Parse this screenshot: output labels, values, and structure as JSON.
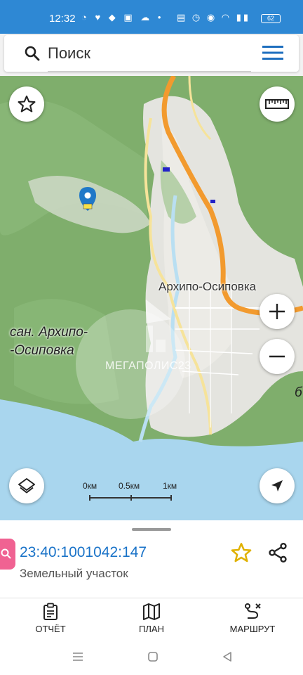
{
  "status_bar": {
    "time": "12:32",
    "battery": "62"
  },
  "search": {
    "placeholder": "Поиск"
  },
  "map": {
    "town_label": "Архипо-Осиповка",
    "sanatorium_label_line1": "сан. Архипо-",
    "sanatorium_label_line2": "-Осиповка",
    "edge_label": "б",
    "watermark": "МЕГАПОЛИС23",
    "scale": {
      "labels": [
        "0км",
        "0.5км",
        "1км"
      ]
    },
    "buttons": {
      "favorite": "star-icon",
      "ruler": "ruler-icon",
      "zoom_in": "plus-icon",
      "zoom_out": "minus-icon",
      "layers": "layers-icon",
      "locate": "navigation-arrow-icon"
    },
    "colors": {
      "forest": "#7fae6c",
      "urban": "#e4e4df",
      "sea": "#a9d6ee",
      "highway": "#f29a2e",
      "road": "#f6e39a",
      "river": "#b9dff2"
    }
  },
  "parcel": {
    "cadastral_number": "23:40:1001042:147",
    "type": "Земельный участок"
  },
  "bottom_nav": {
    "report": "ОТЧЁТ",
    "plan": "ПЛАН",
    "route": "МАРШРУТ"
  }
}
